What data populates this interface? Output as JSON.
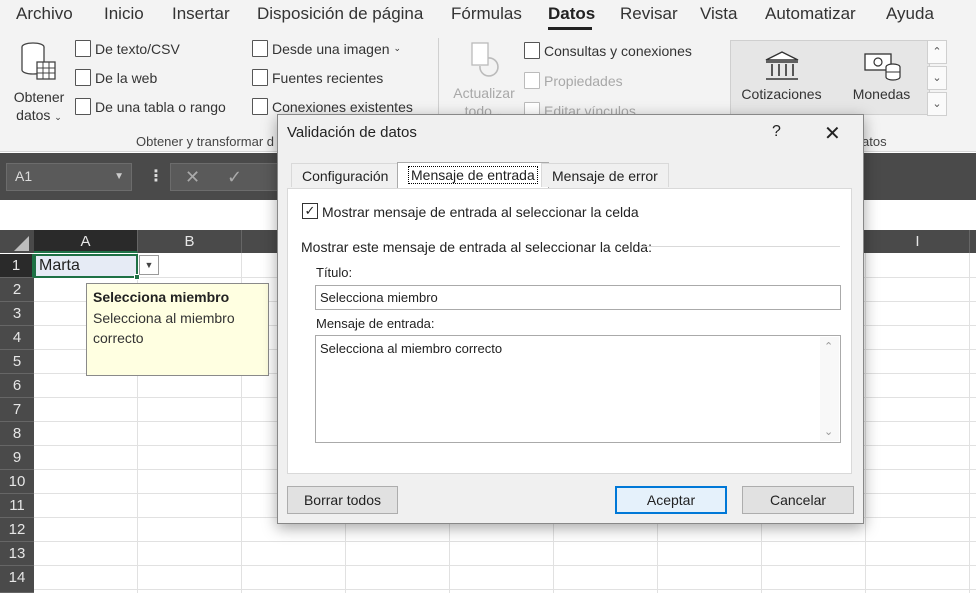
{
  "menu": {
    "tabs": [
      "Archivo",
      "Inicio",
      "Insertar",
      "Disposición de página",
      "Fórmulas",
      "Datos",
      "Revisar",
      "Vista",
      "Automatizar",
      "Ayuda"
    ],
    "active": "Datos"
  },
  "ribbon": {
    "get_data": {
      "line1": "Obtener",
      "line2": "datos"
    },
    "from_text_csv": "De texto/CSV",
    "from_web": "De la web",
    "from_table": "De una tabla o rango",
    "from_image": "Desde una imagen",
    "recent_sources": "Fuentes recientes",
    "existing_connections": "Conexiones existentes",
    "group_get_transform": "Obtener y transformar d",
    "refresh_all": {
      "line1": "Actualizar",
      "line2": "todo"
    },
    "queries_connections": "Consultas y conexiones",
    "properties": "Propiedades",
    "edit_links": "Editar vínculos",
    "stocks": "Cotizaciones",
    "currencies": "Monedas",
    "group_data_types_tail": "atos"
  },
  "formula_bar": {
    "name_box": "A1",
    "cancel_icon": "x-icon",
    "enter_icon": "check-icon"
  },
  "grid": {
    "columns": [
      "A",
      "B",
      "I"
    ],
    "rows": [
      "1",
      "2",
      "3",
      "4",
      "5",
      "6",
      "7",
      "8",
      "9",
      "10",
      "11",
      "12",
      "13",
      "14"
    ],
    "a1_value": "Marta"
  },
  "tooltip": {
    "title": "Selecciona miembro",
    "body": "Selecciona al miembro correcto"
  },
  "dialog": {
    "title": "Validación de datos",
    "help": "?",
    "close": "✕",
    "tabs": [
      "Configuración",
      "Mensaje de entrada",
      "Mensaje de error"
    ],
    "active_tab": "Mensaje de entrada",
    "show_checkbox_label": "Mostrar mensaje de entrada al seleccionar la celda",
    "show_checkbox_checked": true,
    "section_label": "Mostrar este mensaje de entrada al seleccionar la celda:",
    "title_label": "Título:",
    "title_value": "Selecciona miembro",
    "message_label": "Mensaje de entrada:",
    "message_value": "Selecciona al miembro correcto",
    "clear_all": "Borrar todos",
    "ok": "Aceptar",
    "cancel": "Cancelar"
  }
}
